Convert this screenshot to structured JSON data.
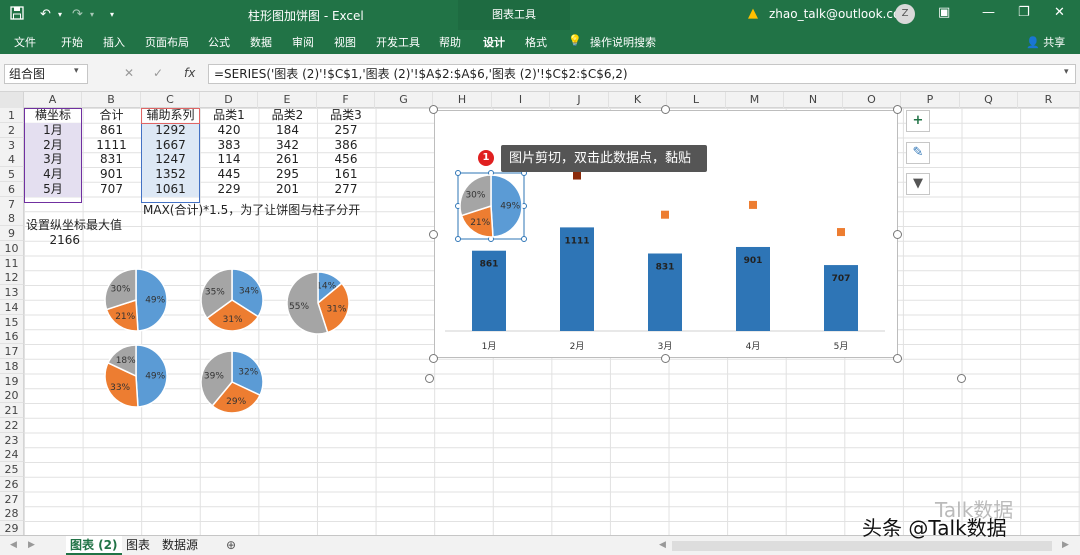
{
  "titlebar": {
    "title": "柱形图加饼图  -  Excel",
    "chart_tools": "图表工具",
    "user": "zhao_talk@outlook.com",
    "avatar": "Z",
    "accent": "#217346"
  },
  "ribbon": {
    "tabs": [
      "文件",
      "开始",
      "插入",
      "页面布局",
      "公式",
      "数据",
      "审阅",
      "视图",
      "开发工具",
      "帮助",
      "设计",
      "格式"
    ],
    "search": "操作说明搜索",
    "share": "共享"
  },
  "formula_bar": {
    "name_box": "组合图",
    "cancel_symbol": "✕",
    "confirm_symbol": "✓",
    "fx": "fx",
    "formula": "=SERIES('图表 (2)'!$C$1,'图表 (2)'!$A$2:$A$6,'图表 (2)'!$C$2:$C$6,2)"
  },
  "columns": [
    "A",
    "B",
    "C",
    "D",
    "E",
    "F",
    "G",
    "H",
    "I",
    "J",
    "K",
    "L",
    "M",
    "N",
    "O",
    "P",
    "Q",
    "R"
  ],
  "rows": [
    "1",
    "2",
    "3",
    "4",
    "5",
    "6",
    "7",
    "8",
    "9",
    "10",
    "11",
    "12",
    "13",
    "14",
    "15",
    "16",
    "17",
    "18",
    "19",
    "20",
    "21",
    "22",
    "23",
    "24",
    "25",
    "26",
    "27",
    "28",
    "29"
  ],
  "table": {
    "headers": [
      "横坐标",
      "合计",
      "辅助系列",
      "品类1",
      "品类2",
      "品类3"
    ],
    "rows": [
      [
        "1月",
        "861",
        "1292",
        "420",
        "184",
        "257"
      ],
      [
        "2月",
        "1111",
        "1667",
        "383",
        "342",
        "386"
      ],
      [
        "3月",
        "831",
        "1247",
        "114",
        "261",
        "456"
      ],
      [
        "4月",
        "901",
        "1352",
        "445",
        "295",
        "161"
      ],
      [
        "5月",
        "707",
        "1061",
        "229",
        "201",
        "277"
      ]
    ]
  },
  "notes": {
    "row7": "MAX(合计)*1.5，为了让饼图与柱子分开",
    "row8": "设置纵坐标最大值",
    "row9": "2166"
  },
  "tooltip": {
    "badge": "1",
    "text": "图片剪切，双击此数据点，黏贴"
  },
  "side_buttons": [
    "plus-icon",
    "brush-icon",
    "filter-icon"
  ],
  "sheet_tabs": [
    "图表 (2)",
    "图表",
    "数据源"
  ],
  "watermark": {
    "main": "头条 @Talk数据",
    "faint": "Talk数据"
  },
  "colors": {
    "bar": "#2e75b6",
    "pie_blue": "#5b9bd5",
    "pie_orange": "#ed7d31",
    "pie_gray": "#a5a5a5",
    "marker": "#ed7d31"
  },
  "pies": [
    {
      "slices": [
        49,
        21,
        30
      ]
    },
    {
      "slices": [
        34,
        31,
        35
      ]
    },
    {
      "slices": [
        14,
        31,
        55
      ]
    },
    {
      "slices": [
        49,
        33,
        18
      ]
    },
    {
      "slices": [
        32,
        29,
        39
      ]
    }
  ],
  "chart_pie": {
    "slices": [
      49,
      21,
      30
    ]
  },
  "chart_data": {
    "type": "bar",
    "categories": [
      "1月",
      "2月",
      "3月",
      "4月",
      "5月"
    ],
    "series": [
      {
        "name": "合计",
        "values": [
          861,
          1111,
          831,
          901,
          707
        ]
      },
      {
        "name": "辅助系列",
        "values": [
          1292,
          1667,
          1247,
          1352,
          1061
        ]
      }
    ],
    "ylim": [
      0,
      2166
    ],
    "grid": false,
    "legend": "none"
  }
}
